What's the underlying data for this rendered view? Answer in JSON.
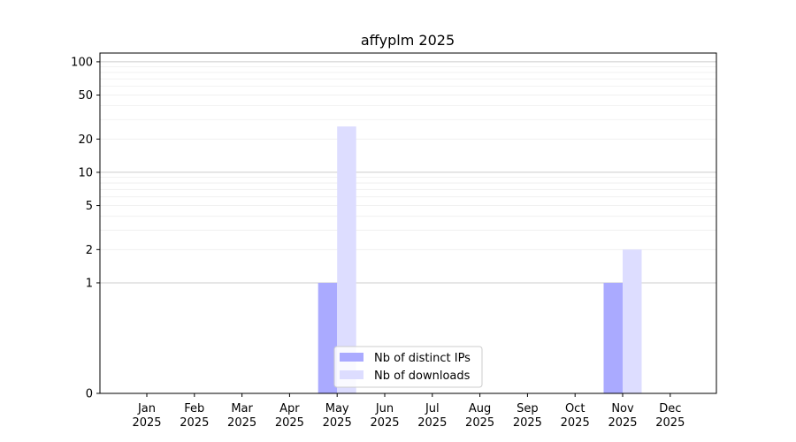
{
  "chart_data": {
    "type": "bar",
    "title": "affyplm 2025",
    "xlabel": "",
    "ylabel": "",
    "y_scale": "symlog",
    "ylim": [
      0,
      120
    ],
    "y_ticks": [
      0,
      1,
      2,
      5,
      10,
      20,
      50,
      100
    ],
    "grid": "horizontal",
    "legend_position": "bottom-center",
    "categories": [
      "Jan\n2025",
      "Feb\n2025",
      "Mar\n2025",
      "Apr\n2025",
      "May\n2025",
      "Jun\n2025",
      "Jul\n2025",
      "Aug\n2025",
      "Sep\n2025",
      "Oct\n2025",
      "Nov\n2025",
      "Dec\n2025"
    ],
    "series": [
      {
        "name": "Nb of distinct IPs",
        "color": "#aaaaff",
        "values": [
          0,
          0,
          0,
          0,
          1,
          0,
          0,
          0,
          0,
          0,
          1,
          0
        ]
      },
      {
        "name": "Nb of downloads",
        "color": "#ddddff",
        "values": [
          0,
          0,
          0,
          0,
          26,
          0,
          0,
          0,
          0,
          0,
          2,
          0
        ]
      }
    ]
  }
}
